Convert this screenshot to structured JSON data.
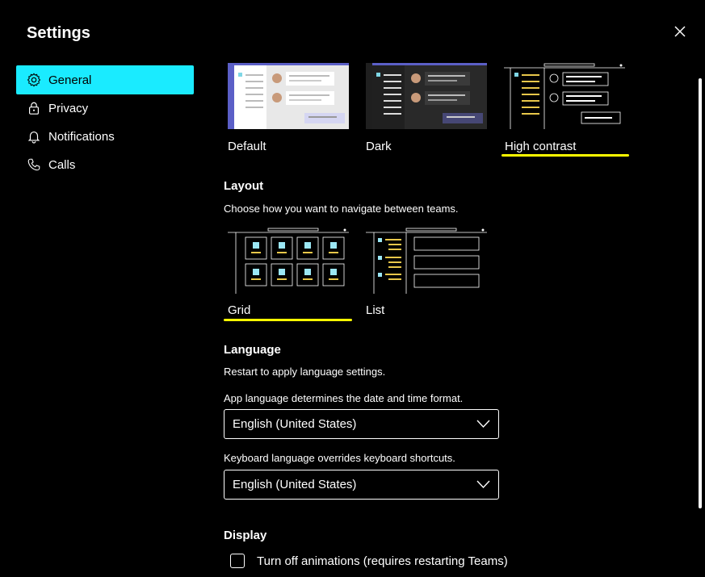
{
  "dialog": {
    "title": "Settings"
  },
  "nav": {
    "items": [
      {
        "label": "General",
        "icon": "gear-icon",
        "active": true
      },
      {
        "label": "Privacy",
        "icon": "lock-icon",
        "active": false
      },
      {
        "label": "Notifications",
        "icon": "bell-icon",
        "active": false
      },
      {
        "label": "Calls",
        "icon": "phone-icon",
        "active": false
      }
    ]
  },
  "theme": {
    "options": [
      {
        "label": "Default",
        "selected": false
      },
      {
        "label": "Dark",
        "selected": false
      },
      {
        "label": "High contrast",
        "selected": true
      }
    ]
  },
  "layout": {
    "heading": "Layout",
    "description": "Choose how you want to navigate between teams.",
    "options": [
      {
        "label": "Grid",
        "selected": true
      },
      {
        "label": "List",
        "selected": false
      }
    ]
  },
  "language": {
    "heading": "Language",
    "restart_note": "Restart to apply language settings.",
    "app_desc": "App language determines the date and time format.",
    "app_value": "English (United States)",
    "keyboard_desc": "Keyboard language overrides keyboard shortcuts.",
    "keyboard_value": "English (United States)"
  },
  "display": {
    "heading": "Display",
    "animations_label": "Turn off animations (requires restarting Teams)",
    "animations_checked": false
  },
  "colors": {
    "accent": "#1aebff",
    "highlight": "#ffff00",
    "background": "#000000"
  }
}
